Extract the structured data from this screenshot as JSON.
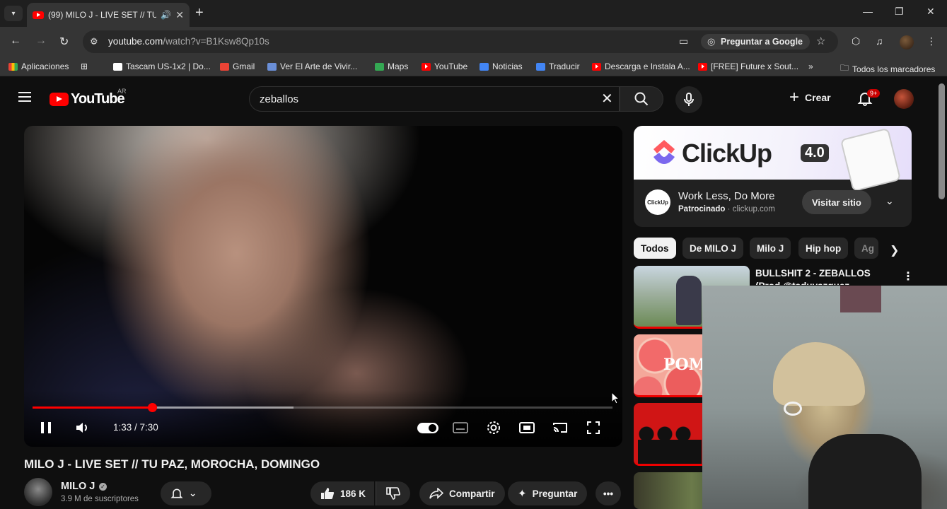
{
  "browser": {
    "tab_title": "(99) MILO J - LIVE SET // TU",
    "url_host": "youtube.com",
    "url_path": "/watch?v=B1Ksw8Qp10s",
    "ask_google": "Preguntar a Google",
    "bookmarks": [
      {
        "label": "Aplicaciones",
        "icon": "grid-icon",
        "color": "#ea4335"
      },
      {
        "label": "Tascam US-1x2 | Do...",
        "icon": "tascam-icon",
        "color": "#ffffff"
      },
      {
        "label": "Gmail",
        "icon": "gmail-icon",
        "color": "#ea4335"
      },
      {
        "label": "Ver El Arte de Vivir...",
        "icon": "site-icon",
        "color": "#6a8fd8"
      },
      {
        "label": "Maps",
        "icon": "maps-icon",
        "color": "#34a853"
      },
      {
        "label": "YouTube",
        "icon": "youtube-icon",
        "color": "#ff0000"
      },
      {
        "label": "Noticias",
        "icon": "news-icon",
        "color": "#4285f4"
      },
      {
        "label": "Traducir",
        "icon": "translate-icon",
        "color": "#4285f4"
      },
      {
        "label": "Descarga e Instala A...",
        "icon": "youtube-icon",
        "color": "#ff0000"
      },
      {
        "label": "[FREE] Future x Sout...",
        "icon": "youtube-icon",
        "color": "#ff0000"
      }
    ],
    "all_bookmarks": "Todos los marcadores"
  },
  "youtube": {
    "logo_text": "YouTube",
    "country_code": "AR",
    "search_value": "zeballos",
    "create_label": "Crear",
    "notification_count": "9+"
  },
  "player": {
    "time_display": "1:33 / 7:30",
    "progress_fraction": 0.2067,
    "buffer_fraction": 0.45
  },
  "video": {
    "title": "MILO J - LIVE SET // TU PAZ, MOROCHA, DOMINGO",
    "channel_name": "MILO J",
    "subscribers": "3.9 M de suscriptores",
    "likes": "186 K",
    "share_label": "Compartir",
    "ask_label": "Preguntar"
  },
  "ad": {
    "brand": "ClickUp",
    "version": "4.0",
    "icon_text": "ClickUp",
    "headline": "Work Less, Do More",
    "sponsored": "Patrocinado",
    "domain": "clickup.com",
    "cta": "Visitar sitio"
  },
  "chips": [
    "Todos",
    "De MILO J",
    "Milo J",
    "Hip hop",
    "Ag"
  ],
  "recommendations": [
    {
      "title": "BULLSHIT 2 - ZEBALLOS (Prod @taduvazquez @FOSSEZM )"
    }
  ],
  "colors": {
    "accent": "#ff0000",
    "background": "#0f0f0f",
    "surface": "#272727"
  }
}
